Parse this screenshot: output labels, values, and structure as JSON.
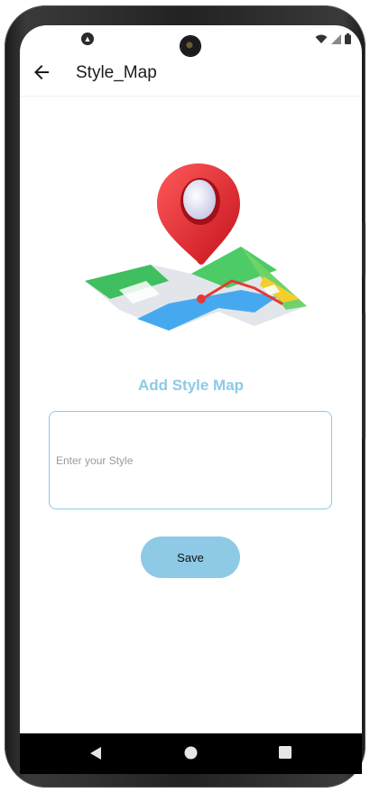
{
  "status_bar": {
    "left_icon": "app-notification-icon",
    "right_icons": [
      "wifi-icon",
      "signal-icon",
      "battery-icon"
    ]
  },
  "app_bar": {
    "title": "Style_Map",
    "back_icon": "arrow-back-icon"
  },
  "main": {
    "illustration": "map-location-pin-illustration",
    "section_title": "Add Style Map",
    "style_input": {
      "placeholder": "Enter your Style",
      "value": ""
    },
    "save_label": "Save"
  },
  "nav_bar": {
    "items": [
      "back-triangle-icon",
      "home-circle-icon",
      "recents-square-icon"
    ]
  },
  "colors": {
    "accent": "#8ecae6",
    "pin": "#e53935",
    "nav_bg": "#000000"
  }
}
